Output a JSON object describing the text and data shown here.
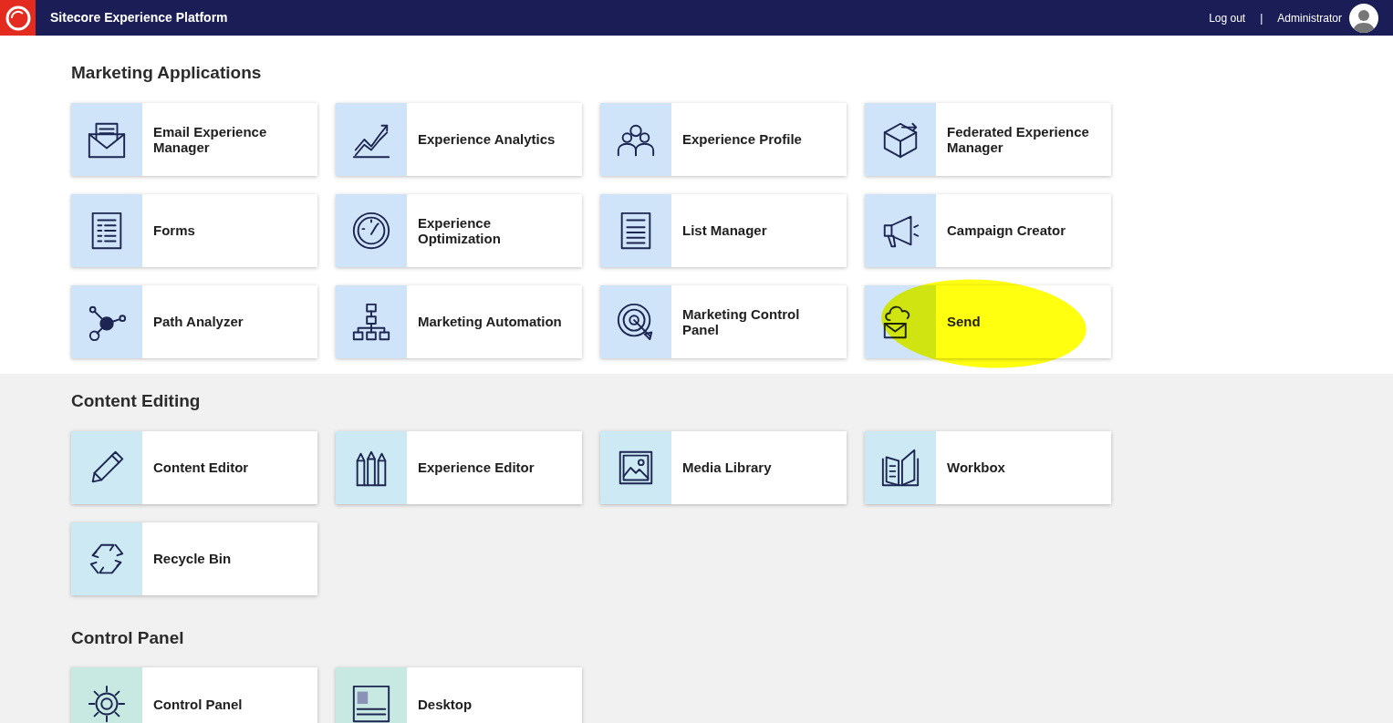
{
  "header": {
    "title": "Sitecore Experience Platform",
    "logout": "Log out",
    "separator": "|",
    "user": "Administrator"
  },
  "sections": [
    {
      "title": "Marketing Applications",
      "color": "#cfe4f8",
      "tiles": [
        {
          "label": "Email Experience Manager",
          "kind": "envelope",
          "highlighted": false
        },
        {
          "label": "Experience Analytics",
          "kind": "chart",
          "highlighted": false
        },
        {
          "label": "Experience Profile",
          "kind": "people",
          "highlighted": false
        },
        {
          "label": "Federated Experience Manager",
          "kind": "cube",
          "highlighted": false
        },
        {
          "label": "Forms",
          "kind": "form",
          "highlighted": false
        },
        {
          "label": "Experience Optimization",
          "kind": "gauge",
          "highlighted": false
        },
        {
          "label": "List Manager",
          "kind": "list",
          "highlighted": false
        },
        {
          "label": "Campaign Creator",
          "kind": "megaphone",
          "highlighted": false
        },
        {
          "label": "Path Analyzer",
          "kind": "nodes",
          "highlighted": false
        },
        {
          "label": "Marketing Automation",
          "kind": "hierarchy",
          "highlighted": false
        },
        {
          "label": "Marketing Control Panel",
          "kind": "target",
          "highlighted": false
        },
        {
          "label": "Send",
          "kind": "cloudmail",
          "highlighted": true
        }
      ]
    },
    {
      "title": "Content Editing",
      "color": "#cdeaf4",
      "tiles": [
        {
          "label": "Content Editor",
          "kind": "pencil",
          "highlighted": false
        },
        {
          "label": "Experience Editor",
          "kind": "pencils",
          "highlighted": false
        },
        {
          "label": "Media Library",
          "kind": "picture",
          "highlighted": false
        },
        {
          "label": "Workbox",
          "kind": "book",
          "highlighted": false
        },
        {
          "label": "Recycle Bin",
          "kind": "recycle",
          "highlighted": false
        }
      ]
    },
    {
      "title": "Control Panel",
      "color": "#c8e9e2",
      "tiles": [
        {
          "label": "Control Panel",
          "kind": "gear",
          "highlighted": false
        },
        {
          "label": "Desktop",
          "kind": "desktop",
          "highlighted": false
        }
      ]
    }
  ]
}
